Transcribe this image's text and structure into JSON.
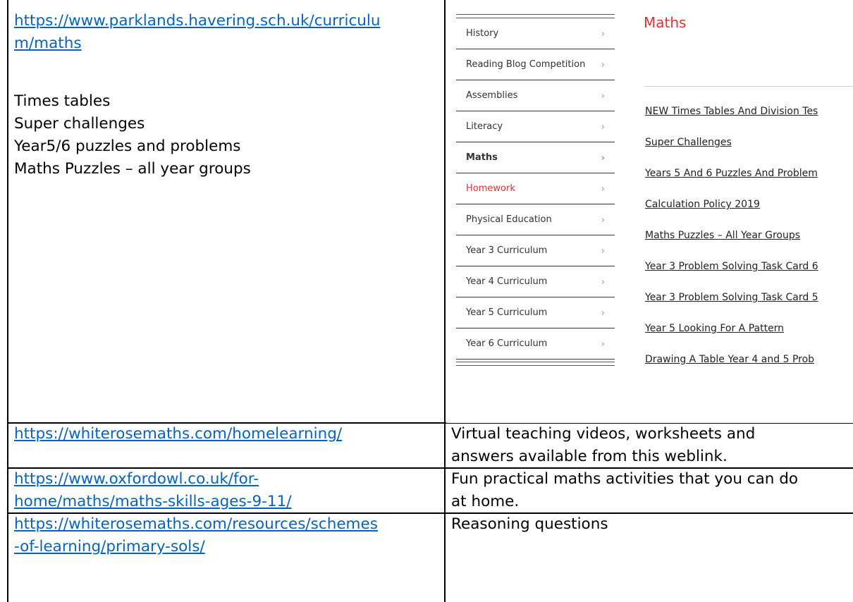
{
  "row1": {
    "url_line1": "https://www.parklands.havering.sch.uk/curriculu",
    "url_line2": "m/maths",
    "items": [
      "Times tables",
      "Super challenges",
      "Year5/6 puzzles and problems",
      "Maths Puzzles – all year groups"
    ]
  },
  "screenshot": {
    "title": "Maths",
    "menu": [
      {
        "label": "History",
        "style": "normal"
      },
      {
        "label": "Reading Blog Competition",
        "style": "normal"
      },
      {
        "label": "Assemblies",
        "style": "normal"
      },
      {
        "label": "Literacy",
        "style": "normal"
      },
      {
        "label": "Maths",
        "style": "bold"
      },
      {
        "label": "Homework",
        "style": "red"
      },
      {
        "label": "Physical Education",
        "style": "normal"
      },
      {
        "label": "Year 3 Curriculum",
        "style": "normal"
      },
      {
        "label": "Year 4 Curriculum",
        "style": "normal"
      },
      {
        "label": "Year 5 Curriculum",
        "style": "normal"
      },
      {
        "label": "Year 6 Curriculum",
        "style": "normal"
      }
    ],
    "chevron": "›",
    "links": [
      "NEW Times Tables And Division Tes",
      "Super Challenges",
      "Years 5 And 6 Puzzles And Problem",
      "Calculation Policy 2019",
      "Maths Puzzles – All Year Groups",
      "Year 3 Problem Solving Task Card 6",
      "Year 3 Problem Solving Task Card 5",
      "Year 5 Looking For A Pattern",
      "Drawing A Table Year 4 and 5 Prob"
    ]
  },
  "row2": {
    "url": "https://whiterosemaths.com/homelearning/",
    "desc_line1": "Virtual teaching videos, worksheets and",
    "desc_line2": "answers available from this weblink."
  },
  "row3": {
    "url_line1": "https://www.oxfordowl.co.uk/for-",
    "url_line2": "home/maths/maths-skills-ages-9-11/",
    "desc_line1": "Fun practical maths activities that you can do",
    "desc_line2": "at home."
  },
  "row4": {
    "url_line1": "https://whiterosemaths.com/resources/schemes",
    "url_line2": "-of-learning/primary-sols/",
    "desc": "Reasoning questions"
  }
}
